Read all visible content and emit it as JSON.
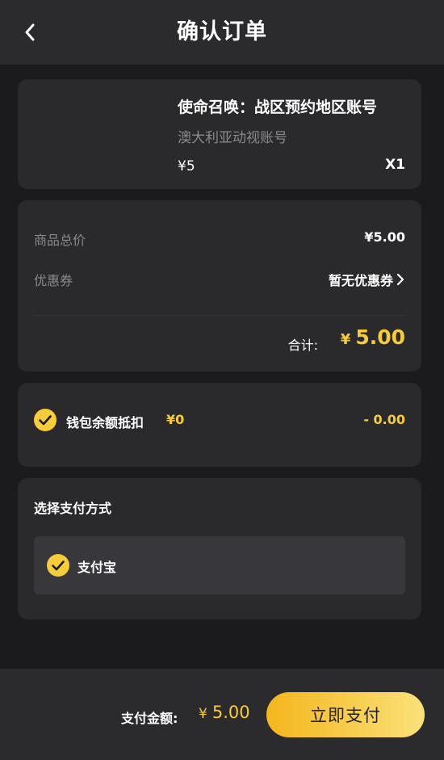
{
  "header": {
    "title": "确认订单"
  },
  "product": {
    "title": "使命召唤：战区预约地区账号",
    "subtitle": "澳大利亚动视账号",
    "price": "¥5",
    "quantity": "X1"
  },
  "pricing": {
    "subtotal_label": "商品总价",
    "subtotal_value": "¥5.00",
    "coupon_label": "优惠券",
    "coupon_value": "暂无优惠券",
    "total_label": "合计:",
    "total_currency": "¥",
    "total_value": "5.00"
  },
  "wallet": {
    "checked": true,
    "label": "钱包余额抵扣",
    "balance": "¥0",
    "deduction": "- 0.00"
  },
  "payment": {
    "section_title": "选择支付方式",
    "options": [
      {
        "label": "支付宝",
        "selected": true
      }
    ]
  },
  "footer": {
    "amount_label": "支付金额:",
    "amount_currency": "¥",
    "amount_value": "5.00",
    "pay_button_label": "立即支付"
  },
  "colors": {
    "accent": "#f6cc3a",
    "background": "#1b1b1d",
    "card": "#2a2a2d",
    "header": "#2b2b2e"
  }
}
